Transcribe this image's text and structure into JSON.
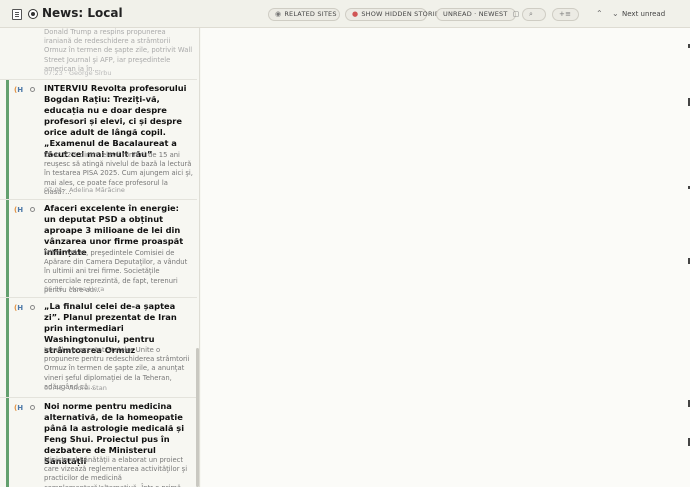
{
  "header": {
    "title": "News: Local",
    "related_sites": "RELATED SITES",
    "show_hidden": "SHOW HIDDEN STORIES",
    "order": "UNREAD · NEWEST",
    "next_unread": "Next unread"
  },
  "icons": {
    "feed": "feed-icon",
    "unread_dot": "dot-icon",
    "related": "eye-icon",
    "hidden": "hidden-icon",
    "search": "search-icon",
    "mark_read": "mark-read-icon",
    "up": "chevron-up-icon",
    "down": "chevron-down-icon"
  },
  "colors": {
    "unread_bar": "#63a06e",
    "source_logo": "#4d78a8",
    "hidden_icon": "#d05555"
  },
  "stories": [
    {
      "source": "H",
      "title": "",
      "snippet": "Donald Trump a respins propunerea iraniană de redeschidere a strâmtorii Ormuz în termen de şapte zile, potrivit Wall Street Journal şi AFP, iar preşedintele american ia în...",
      "time": "07:23",
      "author": "George Sîrbu"
    },
    {
      "source": "H",
      "title": "INTERVIU Revolta profesorului Bogdan Rațiu: Treziți-vă, educația nu e doar despre profesori și elevi, ci și despre orice adult de lângă copil. „Examenul de Bacalaureat a făcut cel mai mult rău”",
      "snippet": "Doar 52% dintre elevii români de 15 ani reuşesc să atingă nivelul de bază la lectură în testarea PISA 2025. Cum ajungem aici şi, mai ales, ce poate face profesorul la clasă?...",
      "time": "07:01",
      "author": "Adelina Mărăcine"
    },
    {
      "source": "H",
      "title": "Afaceri excelente în energie: un deputat PSD a obținut aproape 3 milioane de lei din vânzarea unor firme proaspăt înființate",
      "snippet": "Mihai Weber, preşedintele Comisiei de Apărare din Camera Deputaţilor, a vândut în ultimii ani trei firme. Societăţile comerciale reprezintă, de fapt, terenuri pentru care au...",
      "time": "06:56",
      "author": "Mona Hera"
    },
    {
      "source": "H",
      "title": "„La finalul celei de-a șaptea zi”. Planul prezentat de Iran prin intermediari Washingtonului, pentru strâmtoarea Ormuz",
      "snippet": "Iranul a prezentat Statelor Unite o propunere pentru redeschiderea strâmtorii Ormuz în termen de şapte zile, a anunţat vineri şeful diplomaţiei de la Teheran, adăugând că...",
      "time": "00:46",
      "author": "Andrei Stan"
    },
    {
      "source": "H",
      "title": "Noi norme pentru medicina alternativă, de la homeopatie până la astrologie medicală și Feng Shui. Proiectul pus în dezbatere de Ministerul Sănătății",
      "snippet": "Ministerul Sănătăţii a elaborat un proiect care vizează reglementarea activităţilor şi practicilor de medicină complementară/alternativă. Într-o primă...",
      "time": "",
      "author": ""
    }
  ]
}
